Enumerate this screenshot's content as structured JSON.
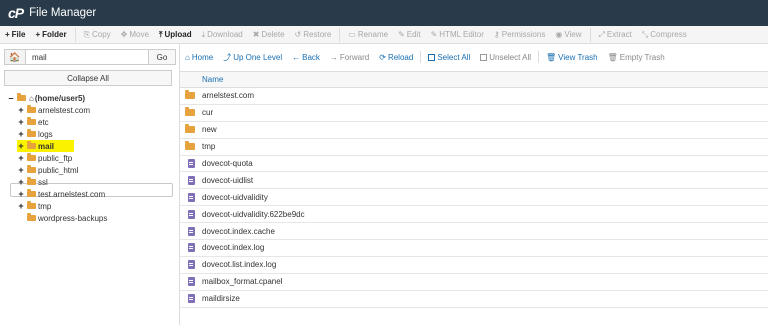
{
  "app": {
    "title": "File Manager",
    "logo": "cP"
  },
  "toolbar": [
    {
      "label": "File",
      "icon": "+",
      "icon_name": "plus-icon",
      "enabled": true,
      "name": "new-file-button"
    },
    {
      "label": "Folder",
      "icon": "+",
      "icon_name": "plus-icon",
      "enabled": true,
      "name": "new-folder-button"
    },
    {
      "label": "Copy",
      "icon": "⎘",
      "icon_name": "copy-icon",
      "enabled": false,
      "name": "copy-button"
    },
    {
      "label": "Move",
      "icon": "✥",
      "icon_name": "move-icon",
      "enabled": false,
      "name": "move-button"
    },
    {
      "label": "Upload",
      "icon": "⤒",
      "icon_name": "upload-icon",
      "enabled": true,
      "name": "upload-button"
    },
    {
      "label": "Download",
      "icon": "⤓",
      "icon_name": "download-icon",
      "enabled": false,
      "name": "download-button"
    },
    {
      "label": "Delete",
      "icon": "✖",
      "icon_name": "delete-icon",
      "enabled": false,
      "name": "delete-button"
    },
    {
      "label": "Restore",
      "icon": "↺",
      "icon_name": "restore-icon",
      "enabled": false,
      "name": "restore-button"
    },
    {
      "label": "Rename",
      "icon": "▭",
      "icon_name": "rename-icon",
      "enabled": false,
      "name": "rename-button"
    },
    {
      "label": "Edit",
      "icon": "✎",
      "icon_name": "edit-icon",
      "enabled": false,
      "name": "edit-button"
    },
    {
      "label": "HTML Editor",
      "icon": "✎",
      "icon_name": "html-editor-icon",
      "enabled": false,
      "name": "html-editor-button"
    },
    {
      "label": "Permissions",
      "icon": "⚷",
      "icon_name": "key-icon",
      "enabled": false,
      "name": "permissions-button"
    },
    {
      "label": "View",
      "icon": "◉",
      "icon_name": "eye-icon",
      "enabled": false,
      "name": "view-button"
    },
    {
      "label": "Extract",
      "icon": "⤢",
      "icon_name": "extract-icon",
      "enabled": false,
      "name": "extract-button"
    },
    {
      "label": "Compress",
      "icon": "⤡",
      "icon_name": "compress-icon",
      "enabled": false,
      "name": "compress-button"
    }
  ],
  "sidebar": {
    "home_icon": "🏠",
    "search_value": "mail",
    "go_label": "Go",
    "collapse_label": "Collapse All",
    "tree": [
      {
        "label": "(home/user5)",
        "toggle": "–",
        "level": 0,
        "type": "home"
      },
      {
        "label": "arnelstest.com",
        "toggle": "+",
        "level": 1
      },
      {
        "label": "etc",
        "toggle": "+",
        "level": 1
      },
      {
        "label": "logs",
        "toggle": "+",
        "level": 1
      },
      {
        "label": "mail",
        "toggle": "+",
        "level": 1,
        "selected": true
      },
      {
        "label": "public_ftp",
        "toggle": "+",
        "level": 1
      },
      {
        "label": "public_html",
        "toggle": "+",
        "level": 1
      },
      {
        "label": "ssl",
        "toggle": "+",
        "level": 1
      },
      {
        "label": "test.arnelstest.com",
        "toggle": "+",
        "level": 1
      },
      {
        "label": "tmp",
        "toggle": "+",
        "level": 1
      },
      {
        "label": "wordpress-backups",
        "toggle": "",
        "level": 1
      }
    ]
  },
  "nav": [
    {
      "label": "Home",
      "icon": "⌂",
      "icon_name": "home-icon",
      "style": "blue",
      "name": "home-button"
    },
    {
      "label": "Up One Level",
      "icon": "⤴",
      "icon_name": "up-level-icon",
      "style": "blue",
      "name": "up-one-level-button"
    },
    {
      "label": "Back",
      "icon": "←",
      "icon_name": "arrow-left-icon",
      "style": "blue",
      "name": "back-button"
    },
    {
      "label": "Forward",
      "icon": "→",
      "icon_name": "arrow-right-icon",
      "style": "gray",
      "name": "forward-button"
    },
    {
      "label": "Reload",
      "icon": "⟳",
      "icon_name": "reload-icon",
      "style": "blue",
      "name": "reload-button"
    },
    {
      "label": "Select All",
      "icon": "checkbox",
      "icon_name": "checkbox-icon",
      "style": "blue",
      "name": "select-all-button"
    },
    {
      "label": "Unselect All",
      "icon": "checkbox-off",
      "icon_name": "checkbox-empty-icon",
      "style": "gray",
      "name": "unselect-all-button"
    },
    {
      "label": "View Trash",
      "icon": "🗑",
      "icon_name": "trash-icon",
      "style": "blue",
      "name": "view-trash-button"
    },
    {
      "label": "Empty Trash",
      "icon": "🗑",
      "icon_name": "trash-icon",
      "style": "gray",
      "name": "empty-trash-button"
    }
  ],
  "table": {
    "header_name": "Name",
    "rows": [
      {
        "name": "arnelstest.com",
        "type": "folder"
      },
      {
        "name": "cur",
        "type": "folder"
      },
      {
        "name": "new",
        "type": "folder"
      },
      {
        "name": "tmp",
        "type": "folder"
      },
      {
        "name": "dovecot-quota",
        "type": "file"
      },
      {
        "name": "dovecot-uidlist",
        "type": "file"
      },
      {
        "name": "dovecot-uidvalidity",
        "type": "file"
      },
      {
        "name": "dovecot-uidvalidity.622be9dc",
        "type": "file"
      },
      {
        "name": "dovecot.index.cache",
        "type": "file"
      },
      {
        "name": "dovecot.index.log",
        "type": "file"
      },
      {
        "name": "dovecot.list.index.log",
        "type": "file"
      },
      {
        "name": "mailbox_format.cpanel",
        "type": "file"
      },
      {
        "name": "maildirsize",
        "type": "file"
      }
    ]
  },
  "colors": {
    "titlebar": "#293a4a",
    "link_blue": "#1a6fb0",
    "folder_orange": "#e6a23c",
    "file_purple": "#7f6fb7",
    "highlight_yellow": "#fbf200"
  }
}
